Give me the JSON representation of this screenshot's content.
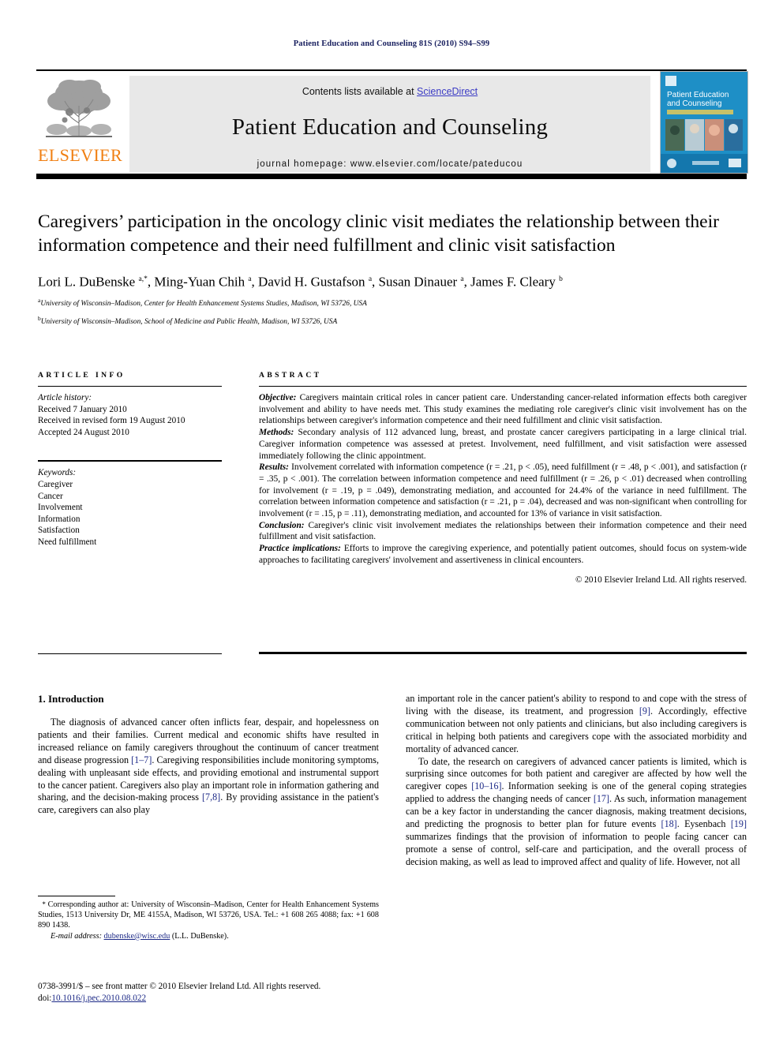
{
  "running_head": "Patient Education and Counseling 81S (2010) S94–S99",
  "masthead": {
    "contents_prefix": "Contents lists available at ",
    "sciencedirect": "ScienceDirect",
    "journal_title": "Patient Education and Counseling",
    "homepage": "journal homepage: www.elsevier.com/locate/pateducou",
    "publisher_wordmark": "ELSEVIER",
    "cover_title_line1": "Patient Education",
    "cover_title_line2": "and Counseling"
  },
  "article": {
    "title": "Caregivers’ participation in the oncology clinic visit mediates the relationship between their information competence and their need fulfillment and clinic visit satisfaction",
    "authors_html": "Lori L. DuBenske <sup>a,*</sup>, Ming-Yuan Chih <sup>a</sup>, David H. Gustafson <sup>a</sup>, Susan Dinauer <sup>a</sup>, James F. Cleary <sup>b</sup>",
    "affiliations": [
      "University of Wisconsin–Madison, Center for Health Enhancement Systems Studies, Madison, WI 53726, USA",
      "University of Wisconsin–Madison, School of Medicine and Public Health, Madison, WI 53726, USA"
    ],
    "affiliation_marks": [
      "a",
      "b"
    ]
  },
  "article_info": {
    "heading": "ARTICLE INFO",
    "history_label": "Article history:",
    "history": [
      "Received 7 January 2010",
      "Received in revised form 19 August 2010",
      "Accepted 24 August 2010"
    ],
    "keywords_label": "Keywords:",
    "keywords": [
      "Caregiver",
      "Cancer",
      "Involvement",
      "Information",
      "Satisfaction",
      "Need fulfillment"
    ]
  },
  "abstract": {
    "heading": "ABSTRACT",
    "sections": [
      {
        "label": "Objective:",
        "text": "Caregivers maintain critical roles in cancer patient care. Understanding cancer-related information effects both caregiver involvement and ability to have needs met. This study examines the mediating role caregiver's clinic visit involvement has on the relationships between caregiver's information competence and their need fulfillment and clinic visit satisfaction."
      },
      {
        "label": "Methods:",
        "text": "Secondary analysis of 112 advanced lung, breast, and prostate cancer caregivers participating in a large clinical trial. Caregiver information competence was assessed at pretest. Involvement, need fulfillment, and visit satisfaction were assessed immediately following the clinic appointment."
      },
      {
        "label": "Results:",
        "text": "Involvement correlated with information competence (r = .21, p < .05), need fulfillment (r = .48, p < .001), and satisfaction (r = .35, p < .001). The correlation between information competence and need fulfillment (r = .26, p < .01) decreased when controlling for involvement (r = .19, p = .049), demonstrating mediation, and accounted for 24.4% of the variance in need fulfillment. The correlation between information competence and satisfaction (r = .21, p = .04), decreased and was non-significant when controlling for involvement (r = .15, p = .11), demonstrating mediation, and accounted for 13% of variance in visit satisfaction."
      },
      {
        "label": "Conclusion:",
        "text": "Caregiver's clinic visit involvement mediates the relationships between their information competence and their need fulfillment and visit satisfaction."
      },
      {
        "label": "Practice implications:",
        "text": "Efforts to improve the caregiving experience, and potentially patient outcomes, should focus on system-wide approaches to facilitating caregivers' involvement and assertiveness in clinical encounters."
      }
    ],
    "copyright": "© 2010 Elsevier Ireland Ltd. All rights reserved."
  },
  "body": {
    "section_heading": "1. Introduction",
    "left_paragraphs": [
      "The diagnosis of advanced cancer often inflicts fear, despair, and hopelessness on patients and their families. Current medical and economic shifts have resulted in increased reliance on family caregivers throughout the continuum of cancer treatment and disease progression [1–7]. Caregiving responsibilities include monitoring symptoms, dealing with unpleasant side effects, and providing emotional and instrumental support to the cancer patient. Caregivers also play an important role in information gathering and sharing, and the decision-making process [7,8]. By providing assistance in the patient's care, caregivers can also play"
    ],
    "right_paragraphs": [
      "an important role in the cancer patient's ability to respond to and cope with the stress of living with the disease, its treatment, and progression [9]. Accordingly, effective communication between not only patients and clinicians, but also including caregivers is critical in helping both patients and caregivers cope with the associated morbidity and mortality of advanced cancer.",
      "To date, the research on caregivers of advanced cancer patients is limited, which is surprising since outcomes for both patient and caregiver are affected by how well the caregiver copes [10–16]. Information seeking is one of the general coping strategies applied to address the changing needs of cancer [17]. As such, information management can be a key factor in understanding the cancer diagnosis, making treatment decisions, and predicting the prognosis to better plan for future events [18]. Eysenbach [19] summarizes findings that the provision of information to people facing cancer can promote a sense of control, self-care and participation, and the overall process of decision making, as well as lead to improved affect and quality of life. However, not all"
    ]
  },
  "footnote": {
    "corresponding": "Corresponding author at: University of Wisconsin–Madison, Center for Health Enhancement Systems Studies, 1513 University Dr, ME 4155A, Madison, WI 53726, USA. Tel.: +1 608 265 4088; fax: +1 608 890 1438.",
    "email_label": "E-mail address:",
    "email": "dubenske@wisc.edu",
    "email_suffix": "(L.L. DuBenske)."
  },
  "imprint": {
    "issn_line": "0738-3991/$ – see front matter © 2010 Elsevier Ireland Ltd. All rights reserved.",
    "doi_prefix": "doi:",
    "doi": "10.1016/j.pec.2010.08.022"
  },
  "colors": {
    "elsevier_orange": "#f07f12",
    "link_blue": "#1d2a87",
    "sciencedirect_blue": "#3b3bc4",
    "runhead_navy": "#1a2160",
    "cover_blue": "#1e8fc6"
  }
}
